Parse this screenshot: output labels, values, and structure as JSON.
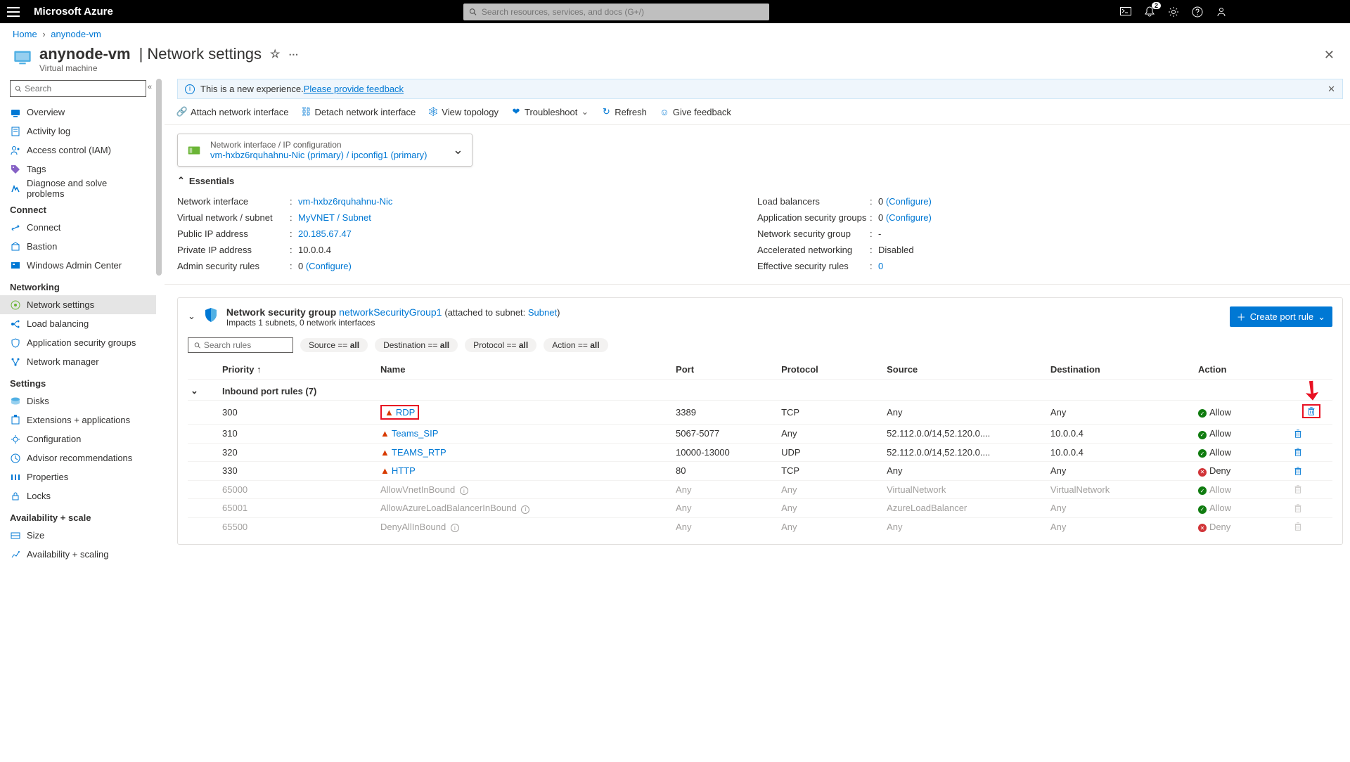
{
  "topbar": {
    "brand": "Microsoft Azure",
    "search_placeholder": "Search resources, services, and docs (G+/)",
    "notification_count": "2"
  },
  "breadcrumb": {
    "home": "Home",
    "resource": "anynode-vm"
  },
  "header": {
    "resource_name": "anynode-vm",
    "page_name": "Network settings",
    "subtitle": "Virtual machine"
  },
  "sidebar": {
    "search_placeholder": "Search",
    "items_top": [
      {
        "label": "Overview",
        "icon": "vm"
      },
      {
        "label": "Activity log",
        "icon": "log"
      },
      {
        "label": "Access control (IAM)",
        "icon": "iam"
      },
      {
        "label": "Tags",
        "icon": "tag"
      },
      {
        "label": "Diagnose and solve problems",
        "icon": "diag"
      }
    ],
    "group_connect": "Connect",
    "items_connect": [
      {
        "label": "Connect",
        "icon": "connect"
      },
      {
        "label": "Bastion",
        "icon": "bastion"
      },
      {
        "label": "Windows Admin Center",
        "icon": "wac"
      }
    ],
    "group_networking": "Networking",
    "items_networking": [
      {
        "label": "Network settings",
        "icon": "netset",
        "active": true
      },
      {
        "label": "Load balancing",
        "icon": "lb"
      },
      {
        "label": "Application security groups",
        "icon": "asg"
      },
      {
        "label": "Network manager",
        "icon": "nm"
      }
    ],
    "group_settings": "Settings",
    "items_settings": [
      {
        "label": "Disks",
        "icon": "disk"
      },
      {
        "label": "Extensions + applications",
        "icon": "ext"
      },
      {
        "label": "Configuration",
        "icon": "cfg"
      },
      {
        "label": "Advisor recommendations",
        "icon": "adv"
      },
      {
        "label": "Properties",
        "icon": "prop"
      },
      {
        "label": "Locks",
        "icon": "lock"
      }
    ],
    "group_avail": "Availability + scale",
    "items_avail": [
      {
        "label": "Size",
        "icon": "size"
      },
      {
        "label": "Availability + scaling",
        "icon": "scale"
      }
    ]
  },
  "banner": {
    "text": "This is a new experience. ",
    "link": "Please provide feedback"
  },
  "toolbar": {
    "attach": "Attach network interface",
    "detach": "Detach network interface",
    "topology": "View topology",
    "troubleshoot": "Troubleshoot",
    "refresh": "Refresh",
    "feedback": "Give feedback"
  },
  "nic_card": {
    "label": "Network interface / IP configuration",
    "value": "vm-hxbz6rquhahnu-Nic (primary) / ipconfig1 (primary)"
  },
  "essentials": {
    "title": "Essentials",
    "left": [
      {
        "label": "Network interface",
        "value": "vm-hxbz6rquhahnu-Nic",
        "link": true
      },
      {
        "label": "Virtual network / subnet",
        "value": "MyVNET / Subnet",
        "link": true
      },
      {
        "label": "Public IP address",
        "value": "20.185.67.47",
        "link": true
      },
      {
        "label": "Private IP address",
        "value": "10.0.0.4"
      },
      {
        "label": "Admin security rules",
        "value": "0",
        "configure": "(Configure)"
      }
    ],
    "right": [
      {
        "label": "Load balancers",
        "value": "0",
        "configure": "(Configure)"
      },
      {
        "label": "Application security groups",
        "value": "0",
        "configure": "(Configure)"
      },
      {
        "label": "Network security group",
        "value": "-"
      },
      {
        "label": "Accelerated networking",
        "value": "Disabled"
      },
      {
        "label": "Effective security rules",
        "value": "0",
        "link": true
      }
    ]
  },
  "nsg": {
    "title_prefix": "Network security group",
    "name": "networkSecurityGroup1",
    "attached": "(attached to subnet: ",
    "subnet": "Subnet",
    "attached_close": ")",
    "impacts": "Impacts 1 subnets, 0 network interfaces",
    "create_btn": "Create port rule",
    "search_placeholder": "Search rules",
    "pills": {
      "source": "Source",
      "dest": "Destination",
      "proto": "Protocol",
      "action": "Action",
      "all": "all"
    },
    "columns": {
      "priority": "Priority",
      "name": "Name",
      "port": "Port",
      "protocol": "Protocol",
      "source": "Source",
      "destination": "Destination",
      "action": "Action"
    },
    "inbound_header": "Inbound port rules (7)",
    "rules": [
      {
        "priority": "300",
        "name": "RDP",
        "warn": true,
        "highlight": true,
        "port": "3389",
        "protocol": "TCP",
        "source": "Any",
        "destination": "Any",
        "action": "Allow",
        "trash_highlight": true
      },
      {
        "priority": "310",
        "name": "Teams_SIP",
        "warn": true,
        "port": "5067-5077",
        "protocol": "Any",
        "source": "52.112.0.0/14,52.120.0....",
        "destination": "10.0.0.4",
        "action": "Allow"
      },
      {
        "priority": "320",
        "name": "TEAMS_RTP",
        "warn": true,
        "port": "10000-13000",
        "protocol": "UDP",
        "source": "52.112.0.0/14,52.120.0....",
        "destination": "10.0.0.4",
        "action": "Allow"
      },
      {
        "priority": "330",
        "name": "HTTP",
        "warn": true,
        "port": "80",
        "protocol": "TCP",
        "source": "Any",
        "destination": "Any",
        "action": "Deny"
      },
      {
        "priority": "65000",
        "name": "AllowVnetInBound",
        "default": true,
        "info": true,
        "port": "Any",
        "protocol": "Any",
        "source": "VirtualNetwork",
        "destination": "VirtualNetwork",
        "action": "Allow"
      },
      {
        "priority": "65001",
        "name": "AllowAzureLoadBalancerInBound",
        "default": true,
        "info": true,
        "port": "Any",
        "protocol": "Any",
        "source": "AzureLoadBalancer",
        "destination": "Any",
        "action": "Allow"
      },
      {
        "priority": "65500",
        "name": "DenyAllInBound",
        "default": true,
        "info": true,
        "port": "Any",
        "protocol": "Any",
        "source": "Any",
        "destination": "Any",
        "action": "Deny"
      }
    ]
  }
}
